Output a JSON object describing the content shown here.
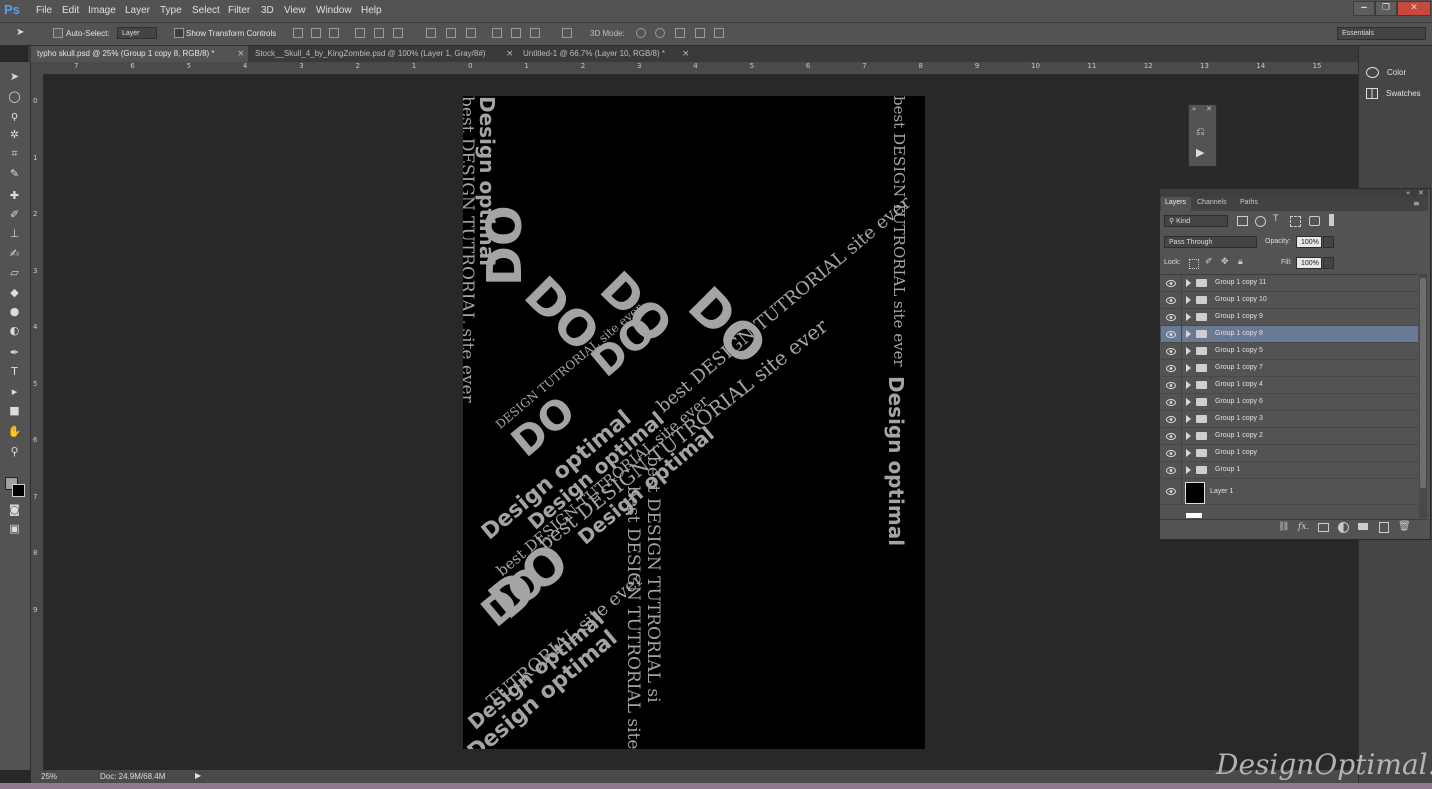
{
  "app": {
    "logo": "Ps"
  },
  "menu": [
    "File",
    "Edit",
    "Image",
    "Layer",
    "Type",
    "Select",
    "Filter",
    "3D",
    "View",
    "Window",
    "Help"
  ],
  "window_controls": {
    "minimize": "‒",
    "restore": "❐",
    "close": "✕"
  },
  "options": {
    "auto_select_label": "Auto-Select:",
    "auto_select_target": "Layer",
    "show_transform_label": "Show Transform Controls",
    "mode_3d_label": "3D Mode:",
    "workspace": "Essentials"
  },
  "tabs": [
    {
      "label": "typho skull.psd @ 25% (Group 1 copy 8, RGB/8) *",
      "active": true
    },
    {
      "label": "Stock__Skull_4_by_KingZombie.psd @ 100% (Layer 1, Gray/8#)",
      "active": false
    },
    {
      "label": "Untitled-1 @ 66.7% (Layer 10, RGB/8) *",
      "active": false
    }
  ],
  "ruler": {
    "top_labels": [
      "7",
      "6",
      "5",
      "4",
      "3",
      "2",
      "1",
      "0",
      "1",
      "2",
      "3",
      "4",
      "5",
      "6",
      "7",
      "8",
      "9",
      "10",
      "11",
      "12",
      "13",
      "14",
      "15"
    ],
    "left_labels": [
      "0",
      "1",
      "2",
      "3",
      "4",
      "5",
      "6",
      "7",
      "8",
      "9"
    ]
  },
  "artwork": {
    "lines": [
      "best DESIGN TUTRORIAL site ever",
      "Design optimal",
      "DO",
      "best DESIGN TUTRORIAL site ever",
      "Design optimal",
      "DO",
      "DO",
      "DO",
      "best DESIGN TUTRORIAL site ever",
      "best DESIGN TUTRORIAL si",
      "DO",
      "DESIGN TUTRORIAL site ever",
      "Design optimal",
      "best DESIGN TUTRORIAL site ever",
      "Design optimal",
      "DO",
      "best DESIGN TUTRORIAL site ever",
      "DO",
      "TUTRORIAL site ever",
      "Design optimal",
      "Design optimal",
      "DO",
      "best DESIGN TUTRORIAL site ever",
      "Design optimal"
    ]
  },
  "status": {
    "zoom": "25%",
    "doc": "Doc: 24.9M/68.4M"
  },
  "dock": [
    {
      "label": "Color",
      "icon": "color-palette-icon"
    },
    {
      "label": "Swatches",
      "icon": "swatches-grid-icon"
    }
  ],
  "layers_panel": {
    "tabs": [
      "Layers",
      "Channels",
      "Paths"
    ],
    "filter_kind": "Kind",
    "blend_mode": "Pass Through",
    "opacity_label": "Opacity:",
    "opacity_value": "100%",
    "lock_label": "Lock:",
    "fill_label": "Fill:",
    "fill_value": "100%",
    "layers": [
      {
        "name": "Group 1 copy 11",
        "type": "group",
        "selected": false
      },
      {
        "name": "Group 1 copy 10",
        "type": "group",
        "selected": false
      },
      {
        "name": "Group 1 copy 9",
        "type": "group",
        "selected": false
      },
      {
        "name": "Group 1 copy 8",
        "type": "group",
        "selected": true
      },
      {
        "name": "Group 1 copy 5",
        "type": "group",
        "selected": false
      },
      {
        "name": "Group 1 copy 7",
        "type": "group",
        "selected": false
      },
      {
        "name": "Group 1 copy 4",
        "type": "group",
        "selected": false
      },
      {
        "name": "Group 1 copy 6",
        "type": "group",
        "selected": false
      },
      {
        "name": "Group 1 copy 3",
        "type": "group",
        "selected": false
      },
      {
        "name": "Group 1 copy 2",
        "type": "group",
        "selected": false
      },
      {
        "name": "Group 1 copy",
        "type": "group",
        "selected": false
      },
      {
        "name": "Group 1",
        "type": "group",
        "selected": false
      },
      {
        "name": "Layer 1",
        "type": "pixel",
        "selected": false
      }
    ],
    "footer_icons": [
      "link-layers-icon",
      "fx-icon",
      "add-mask-icon",
      "adjustment-layer-icon",
      "new-group-icon",
      "new-layer-icon",
      "trash-icon"
    ],
    "footer_fx": "fx."
  },
  "watermark": "DesignOptimal.com"
}
